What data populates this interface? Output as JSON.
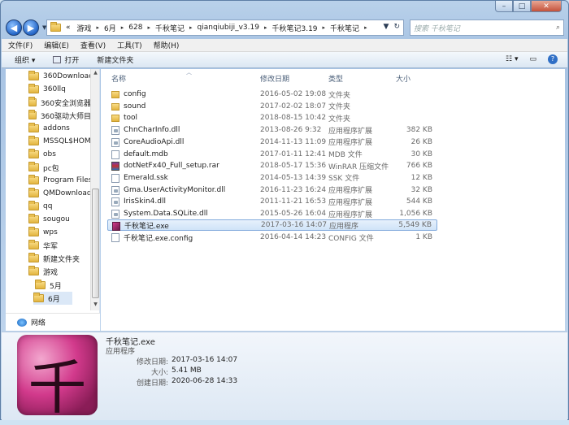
{
  "window": {
    "minimize": "–",
    "maximize": "□",
    "close": "✕"
  },
  "nav": {
    "back": "◀",
    "forward": "▶"
  },
  "address": {
    "overflow": "«",
    "crumbs": [
      "游戏",
      "6月",
      "628",
      "千秋笔记",
      "qianqiubiji_v3.19",
      "千秋笔记3.19",
      "千秋笔记"
    ]
  },
  "search": {
    "placeholder": "搜索 千秋笔记"
  },
  "menu": [
    "文件(F)",
    "编辑(E)",
    "查看(V)",
    "工具(T)",
    "帮助(H)"
  ],
  "toolbar": {
    "organize": "组织 ▾",
    "open": "打开",
    "new_folder": "新建文件夹"
  },
  "sidebar": {
    "items": [
      "360Downloads",
      "360llq",
      "360安全浏览器下",
      "360驱动大师目录",
      "addons",
      "MSSQL$HOME",
      "obs",
      "pc包",
      "Program Files (",
      "QMDownload",
      "qq",
      "sougou",
      "wps",
      "华军",
      "新建文件夹",
      "游戏"
    ],
    "sub": [
      "5月",
      "6月"
    ],
    "network": "网络"
  },
  "columns": {
    "name": "名称",
    "date": "修改日期",
    "type": "类型",
    "size": "大小"
  },
  "files": [
    {
      "name": "config",
      "date": "2016-05-02 19:08",
      "type": "文件夹",
      "size": "",
      "icon": "folder"
    },
    {
      "name": "sound",
      "date": "2017-02-02 18:07",
      "type": "文件夹",
      "size": "",
      "icon": "folder"
    },
    {
      "name": "tool",
      "date": "2018-08-15 10:42",
      "type": "文件夹",
      "size": "",
      "icon": "folder"
    },
    {
      "name": "ChnCharInfo.dll",
      "date": "2013-08-26 9:32",
      "type": "应用程序扩展",
      "size": "382 KB",
      "icon": "dll"
    },
    {
      "name": "CoreAudioApi.dll",
      "date": "2014-11-13 11:09",
      "type": "应用程序扩展",
      "size": "26 KB",
      "icon": "dll"
    },
    {
      "name": "default.mdb",
      "date": "2017-01-11 12:41",
      "type": "MDB 文件",
      "size": "30 KB",
      "icon": "file"
    },
    {
      "name": "dotNetFx40_Full_setup.rar",
      "date": "2018-05-17 15:36",
      "type": "WinRAR 压缩文件",
      "size": "766 KB",
      "icon": "rar"
    },
    {
      "name": "Emerald.ssk",
      "date": "2014-05-13 14:39",
      "type": "SSK 文件",
      "size": "12 KB",
      "icon": "file"
    },
    {
      "name": "Gma.UserActivityMonitor.dll",
      "date": "2016-11-23 16:24",
      "type": "应用程序扩展",
      "size": "32 KB",
      "icon": "dll"
    },
    {
      "name": "IrisSkin4.dll",
      "date": "2011-11-21 16:53",
      "type": "应用程序扩展",
      "size": "544 KB",
      "icon": "dll"
    },
    {
      "name": "System.Data.SQLite.dll",
      "date": "2015-05-26 16:04",
      "type": "应用程序扩展",
      "size": "1,056 KB",
      "icon": "dll"
    },
    {
      "name": "千秋笔记.exe",
      "date": "2017-03-16 14:07",
      "type": "应用程序",
      "size": "5,549 KB",
      "icon": "exe"
    },
    {
      "name": "千秋笔记.exe.config",
      "date": "2016-04-14 14:23",
      "type": "CONFIG 文件",
      "size": "1 KB",
      "icon": "file"
    }
  ],
  "details": {
    "icon_glyph": "千",
    "name": "千秋笔记.exe",
    "type": "应用程序",
    "modified_label": "修改日期:",
    "modified": "2017-03-16 14:07",
    "size_label": "大小:",
    "size": "5.41 MB",
    "created_label": "创建日期:",
    "created": "2020-06-28 14:33"
  }
}
